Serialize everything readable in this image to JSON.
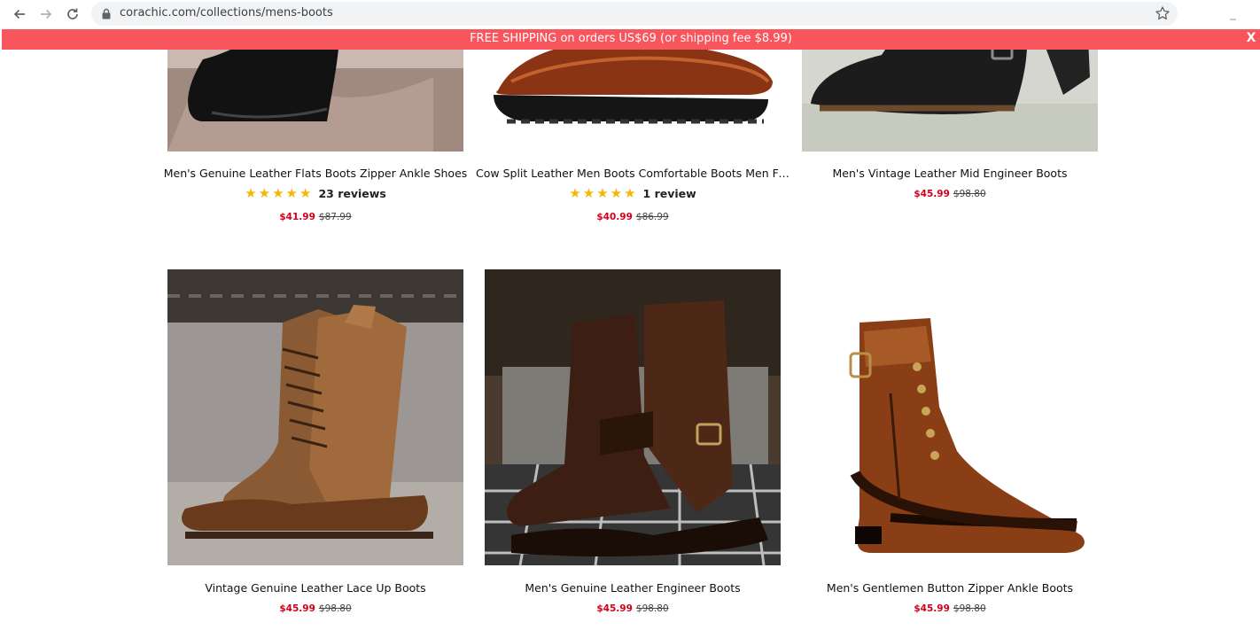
{
  "browser": {
    "url": "corachic.com/collections/mens-boots",
    "icons": [
      "back-arrow-icon",
      "forward-arrow-icon",
      "reload-icon",
      "lock-icon",
      "bookmark-star-icon"
    ]
  },
  "announcement": {
    "text": "FREE SHIPPING on orders US$69 (or shipping fee $8.99)",
    "close_label": "X",
    "color": "#f9555d"
  },
  "colors": {
    "sale_price": "#d0021b",
    "star": "#f5b50a"
  },
  "products": [
    {
      "title": "Men's Genuine Leather Flats Boots Zipper Ankle Shoes",
      "rating_stars": "★★★★★",
      "reviews": "23 reviews",
      "price": "$41.99",
      "compare_price": "$87.99"
    },
    {
      "title": "Cow Split Leather Men Boots Comfortable Boots Men Foo...",
      "rating_stars": "★★★★★",
      "reviews": "1 review",
      "price": "$40.99",
      "compare_price": "$86.99"
    },
    {
      "title": "Men's Vintage Leather Mid Engineer Boots",
      "price": "$45.99",
      "compare_price": "$98.80"
    },
    {
      "title": "Vintage Genuine Leather Lace Up Boots",
      "price": "$45.99",
      "compare_price": "$98.80"
    },
    {
      "title": "Men's Genuine Leather Engineer Boots",
      "price": "$45.99",
      "compare_price": "$98.80"
    },
    {
      "title": "Men's Gentlemen Button Zipper Ankle Boots",
      "price": "$45.99",
      "compare_price": "$98.80"
    }
  ]
}
